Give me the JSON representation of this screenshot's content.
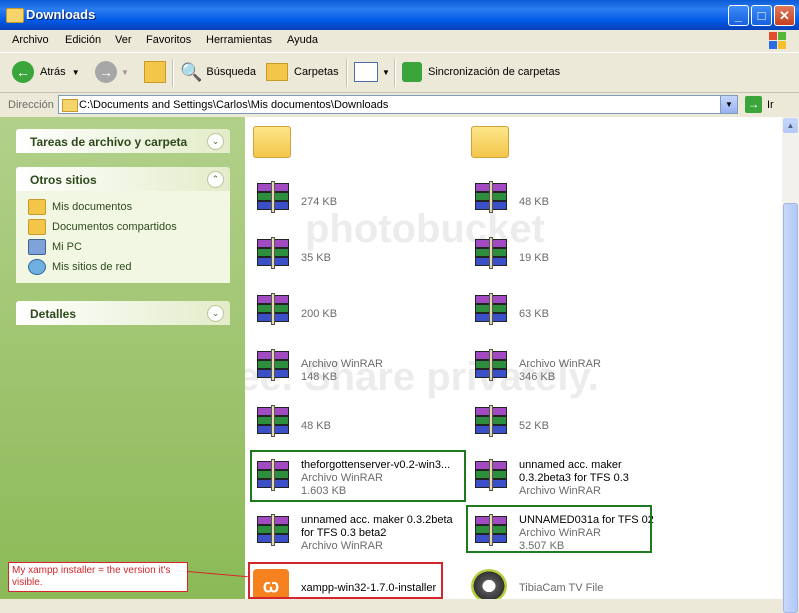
{
  "window": {
    "title": "Downloads"
  },
  "menu": [
    "Archivo",
    "Edición",
    "Ver",
    "Favoritos",
    "Herramientas",
    "Ayuda"
  ],
  "toolbar": {
    "back": "Atrás",
    "search": "Búsqueda",
    "folders": "Carpetas",
    "sync": "Sincronización de carpetas"
  },
  "address": {
    "label": "Dirección",
    "path": "C:\\Documents and Settings\\Carlos\\Mis documentos\\Downloads",
    "go": "Ir"
  },
  "tasks": {
    "file_tasks": "Tareas de archivo y carpeta",
    "other_places": "Otros sitios",
    "places": [
      "Mis documentos",
      "Documentos compartidos",
      "Mi PC",
      "Mis sitios de red"
    ],
    "details": "Detalles"
  },
  "files": [
    {
      "kind": "folder",
      "name": "",
      "type": "",
      "size": ""
    },
    {
      "kind": "folder",
      "name": "",
      "type": "",
      "size": ""
    },
    {
      "kind": "rar",
      "name": "",
      "type": "",
      "size": "274 KB"
    },
    {
      "kind": "rar",
      "name": "",
      "type": "",
      "size": "48 KB"
    },
    {
      "kind": "rar",
      "name": "",
      "type": "",
      "size": "35 KB"
    },
    {
      "kind": "rar",
      "name": "",
      "type": "",
      "size": "19 KB"
    },
    {
      "kind": "rar",
      "name": "",
      "type": "",
      "size": "200 KB"
    },
    {
      "kind": "rar",
      "name": "",
      "type": "",
      "size": "63 KB"
    },
    {
      "kind": "rar",
      "name": "",
      "type": "Archivo WinRAR",
      "size": "148 KB"
    },
    {
      "kind": "rar",
      "name": "",
      "type": "Archivo WinRAR",
      "size": "346 KB"
    },
    {
      "kind": "rar",
      "name": "",
      "type": "",
      "size": "48 KB"
    },
    {
      "kind": "rar",
      "name": "",
      "type": "",
      "size": "52 KB"
    },
    {
      "kind": "rar",
      "name": "theforgottenserver-v0.2-win3...",
      "type": "Archivo WinRAR",
      "size": "1.603 KB"
    },
    {
      "kind": "rar",
      "name": "unnamed acc. maker 0.3.2beta3 for TFS 0.3",
      "type": "Archivo WinRAR",
      "size": ""
    },
    {
      "kind": "rar",
      "name": "unnamed acc. maker 0.3.2beta for TFS 0.3 beta2",
      "type": "Archivo WinRAR",
      "size": ""
    },
    {
      "kind": "rar",
      "name": "UNNAMED031a for TFS 02",
      "type": "Archivo WinRAR",
      "size": "3.507 KB"
    },
    {
      "kind": "xampp",
      "name": "xampp-win32-1.7.0-installer",
      "type": "",
      "size": ""
    },
    {
      "kind": "film",
      "name": "TibiaCam TV File",
      "type": "",
      "size": ""
    }
  ],
  "annotation": {
    "note": "My xampp installer = the version it's visible."
  },
  "watermark": {
    "line1": "photobucket",
    "line2": "Join free. Share privately."
  }
}
